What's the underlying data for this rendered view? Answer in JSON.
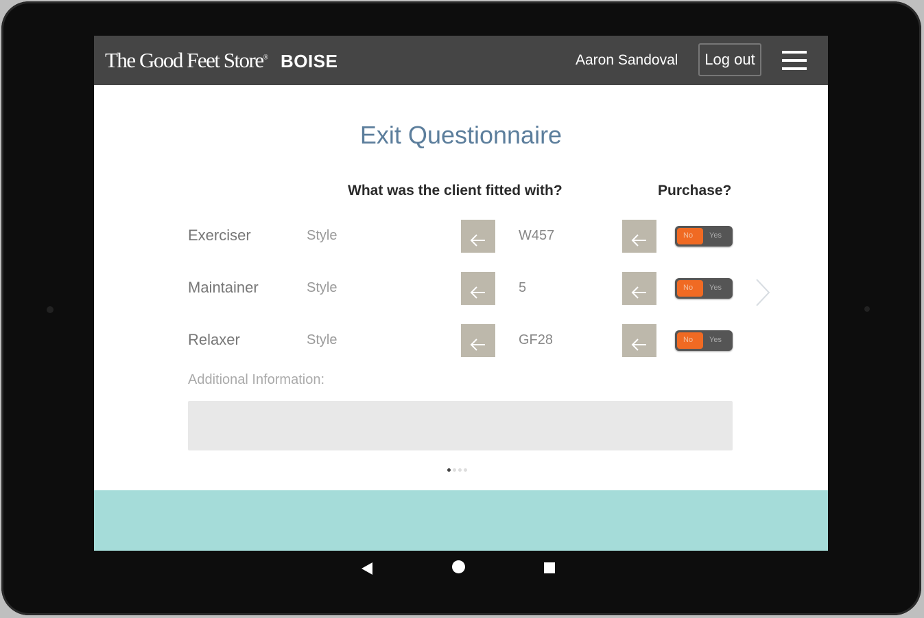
{
  "header": {
    "brand": "The Good Feet Store",
    "city": "BOISE",
    "user_name": "Aaron Sandoval",
    "logout_label": "Log out",
    "menu_icon": "hamburger-menu-icon"
  },
  "page": {
    "title": "Exit Questionnaire",
    "col_fitted": "What was the client fitted with?",
    "col_purchase": "Purchase?"
  },
  "rows": [
    {
      "label": "Exerciser",
      "style": "Style",
      "value": "W457",
      "toggle_no": "No",
      "toggle_yes": "Yes",
      "selected": "No"
    },
    {
      "label": "Maintainer",
      "style": "Style",
      "value": "5",
      "toggle_no": "No",
      "toggle_yes": "Yes",
      "selected": "No"
    },
    {
      "label": "Relaxer",
      "style": "Style",
      "value": "GF28",
      "toggle_no": "No",
      "toggle_yes": "Yes",
      "selected": "No"
    }
  ],
  "additional": {
    "label": "Additional Information:",
    "value": ""
  },
  "pager": {
    "total": 4,
    "current": 1
  },
  "colors": {
    "title": "#5c7e9c",
    "toggle_on": "#f06a23",
    "arrow_button": "#bdb8ab",
    "footer_band": "#a5dcd9",
    "topbar": "#454545"
  },
  "icons": {
    "arrow": "arrow-left-icon",
    "next": "chevron-right-icon",
    "nav_back": "triangle-back-icon",
    "nav_home": "circle-home-icon",
    "nav_recent": "square-recent-icon"
  }
}
